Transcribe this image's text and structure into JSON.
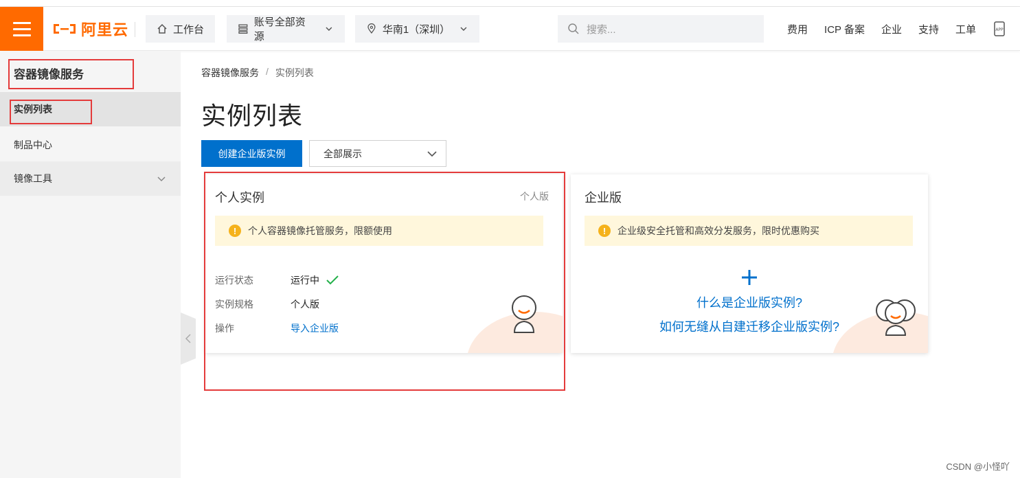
{
  "header": {
    "logo_text": "阿里云",
    "workbench": "工作台",
    "resources": "账号全部资源",
    "region": "华南1（深圳）",
    "search_placeholder": "搜索...",
    "links": [
      "费用",
      "ICP 备案",
      "企业",
      "支持",
      "工单"
    ],
    "brand_color": "#ff6a00"
  },
  "sidebar": {
    "title": "容器镜像服务",
    "items": [
      {
        "label": "实例列表",
        "active": true
      },
      {
        "label": "制品中心",
        "active": false
      },
      {
        "label": "镜像工具",
        "active": false,
        "expandable": true
      }
    ]
  },
  "breadcrumb": [
    "容器镜像服务",
    "/",
    "实例列表"
  ],
  "page_title": "实例列表",
  "toolbar": {
    "create_label": "创建企业版实例",
    "filter_value": "全部展示"
  },
  "personal_card": {
    "title": "个人实例",
    "tag": "个人版",
    "notice": "个人容器镜像托管服务，限额使用",
    "rows": [
      {
        "key": "运行状态",
        "value": "运行中"
      },
      {
        "key": "实例规格",
        "value": "个人版"
      },
      {
        "key": "操作",
        "value": "导入企业版"
      }
    ]
  },
  "enterprise_card": {
    "title": "企业版",
    "notice": "企业级安全托管和高效分发服务，限时优惠购买",
    "link1": "什么是企业版实例?",
    "link2": "如何无缝从自建迁移企业版实例?"
  },
  "watermark": "CSDN @小怪吖"
}
